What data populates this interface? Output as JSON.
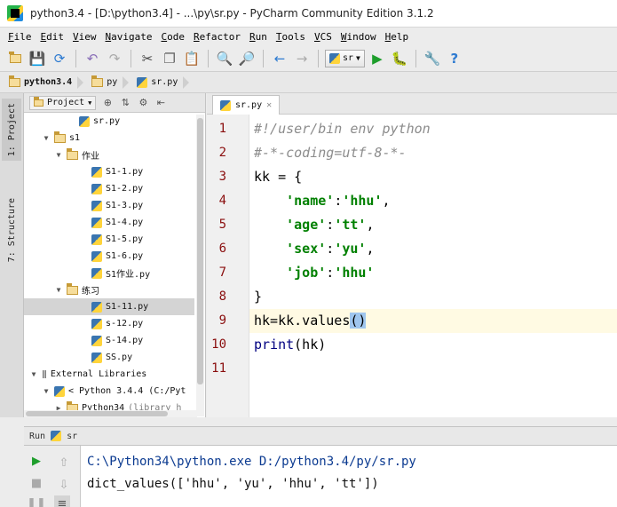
{
  "window": {
    "title": "python3.4 - [D:\\python3.4] - ...\\py\\sr.py - PyCharm Community Edition 3.1.2",
    "app_icon": "pycharm-icon"
  },
  "menu": [
    "File",
    "Edit",
    "View",
    "Navigate",
    "Code",
    "Refactor",
    "Run",
    "Tools",
    "VCS",
    "Window",
    "Help"
  ],
  "toolbar": {
    "run_config_label": "sr"
  },
  "breadcrumbs": [
    "python3.4",
    "py",
    "sr.py"
  ],
  "side_tabs": {
    "project": "1: Project",
    "structure": "7: Structure"
  },
  "project_panel": {
    "dropdown_label": "Project",
    "tree": [
      {
        "label": "sr.py",
        "type": "py",
        "indent": 3,
        "arrow": ""
      },
      {
        "label": "s1",
        "type": "folder",
        "indent": 1,
        "arrow": "down"
      },
      {
        "label": "作业",
        "type": "folder",
        "indent": 2,
        "arrow": "down"
      },
      {
        "label": "S1-1.py",
        "type": "py",
        "indent": 4,
        "arrow": ""
      },
      {
        "label": "S1-2.py",
        "type": "py",
        "indent": 4,
        "arrow": ""
      },
      {
        "label": "S1-3.py",
        "type": "py",
        "indent": 4,
        "arrow": ""
      },
      {
        "label": "S1-4.py",
        "type": "py",
        "indent": 4,
        "arrow": ""
      },
      {
        "label": "S1-5.py",
        "type": "py",
        "indent": 4,
        "arrow": ""
      },
      {
        "label": "S1-6.py",
        "type": "py",
        "indent": 4,
        "arrow": ""
      },
      {
        "label": "S1作业.py",
        "type": "py",
        "indent": 4,
        "arrow": ""
      },
      {
        "label": "练习",
        "type": "folder",
        "indent": 2,
        "arrow": "down"
      },
      {
        "label": "S1-11.py",
        "type": "py",
        "indent": 4,
        "arrow": "",
        "selected": true
      },
      {
        "label": "s-12.py",
        "type": "py",
        "indent": 4,
        "arrow": ""
      },
      {
        "label": "S-14.py",
        "type": "py",
        "indent": 4,
        "arrow": ""
      },
      {
        "label": "SS.py",
        "type": "py",
        "indent": 4,
        "arrow": ""
      },
      {
        "label": "External Libraries",
        "type": "lib",
        "indent": 0,
        "arrow": "down"
      },
      {
        "label": "< Python 3.4.4 (C:/Pyt",
        "type": "python",
        "indent": 1,
        "arrow": "down"
      },
      {
        "label": "Python34",
        "hint": "(library h",
        "type": "folder",
        "indent": 2,
        "arrow": "right"
      }
    ]
  },
  "editor": {
    "tab_label": "sr.py",
    "line_numbers": [
      "1",
      "2",
      "3",
      "4",
      "5",
      "6",
      "7",
      "8",
      "9",
      "10",
      "11"
    ],
    "lines": [
      [
        {
          "t": "#!/user/bin env python",
          "c": "comment"
        }
      ],
      [
        {
          "t": "#-*-coding=utf-8-*-",
          "c": "comment"
        }
      ],
      [
        {
          "t": "kk = {",
          "c": ""
        }
      ],
      [
        {
          "t": "    ",
          "c": ""
        },
        {
          "t": "'name'",
          "c": "str"
        },
        {
          "t": ":",
          "c": ""
        },
        {
          "t": "'hhu'",
          "c": "str"
        },
        {
          "t": ",",
          "c": ""
        }
      ],
      [
        {
          "t": "    ",
          "c": ""
        },
        {
          "t": "'age'",
          "c": "str"
        },
        {
          "t": ":",
          "c": ""
        },
        {
          "t": "'tt'",
          "c": "str"
        },
        {
          "t": ",",
          "c": ""
        }
      ],
      [
        {
          "t": "    ",
          "c": ""
        },
        {
          "t": "'sex'",
          "c": "str"
        },
        {
          "t": ":",
          "c": ""
        },
        {
          "t": "'yu'",
          "c": "str"
        },
        {
          "t": ",",
          "c": ""
        }
      ],
      [
        {
          "t": "    ",
          "c": ""
        },
        {
          "t": "'job'",
          "c": "str"
        },
        {
          "t": ":",
          "c": ""
        },
        {
          "t": "'hhu'",
          "c": "str"
        }
      ],
      [
        {
          "t": "}",
          "c": ""
        }
      ],
      [
        {
          "t": "hk=kk.values",
          "c": ""
        },
        {
          "t": "()",
          "c": "paren"
        }
      ],
      [
        {
          "t": "print",
          "c": "builtin"
        },
        {
          "t": "(hk)",
          "c": ""
        }
      ],
      []
    ],
    "caret_line": 9
  },
  "run": {
    "label": "Run",
    "config": "sr",
    "console": {
      "command": "C:\\Python34\\python.exe D:/python3.4/py/sr.py",
      "output": "dict_values(['hhu', 'yu', 'hhu', 'tt'])"
    }
  }
}
